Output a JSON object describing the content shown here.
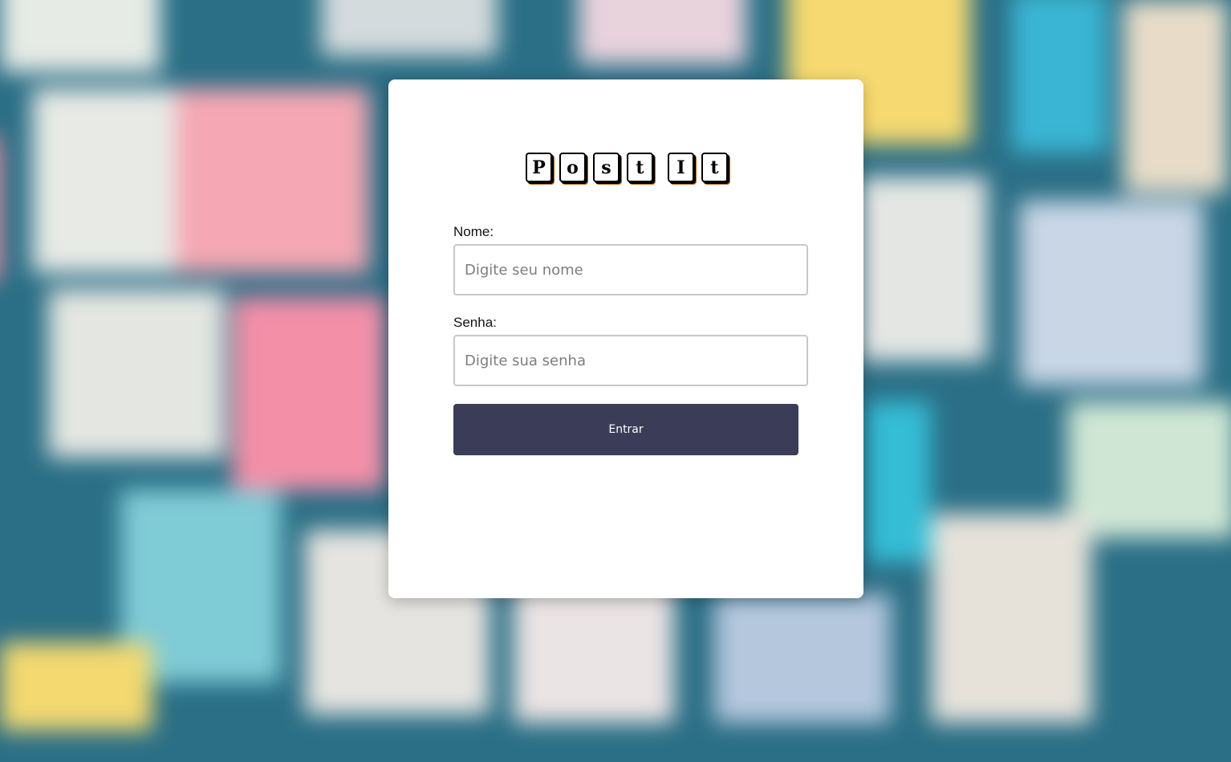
{
  "logo": {
    "letters": [
      "P",
      "o",
      "s",
      "t",
      "I",
      "t"
    ]
  },
  "form": {
    "name_label": "Nome:",
    "name_placeholder": "Digite seu nome",
    "password_label": "Senha:",
    "password_placeholder": "Digite sua senha",
    "submit_label": "Entrar"
  },
  "colors": {
    "button": "#3b3d58",
    "card": "#ffffff"
  }
}
